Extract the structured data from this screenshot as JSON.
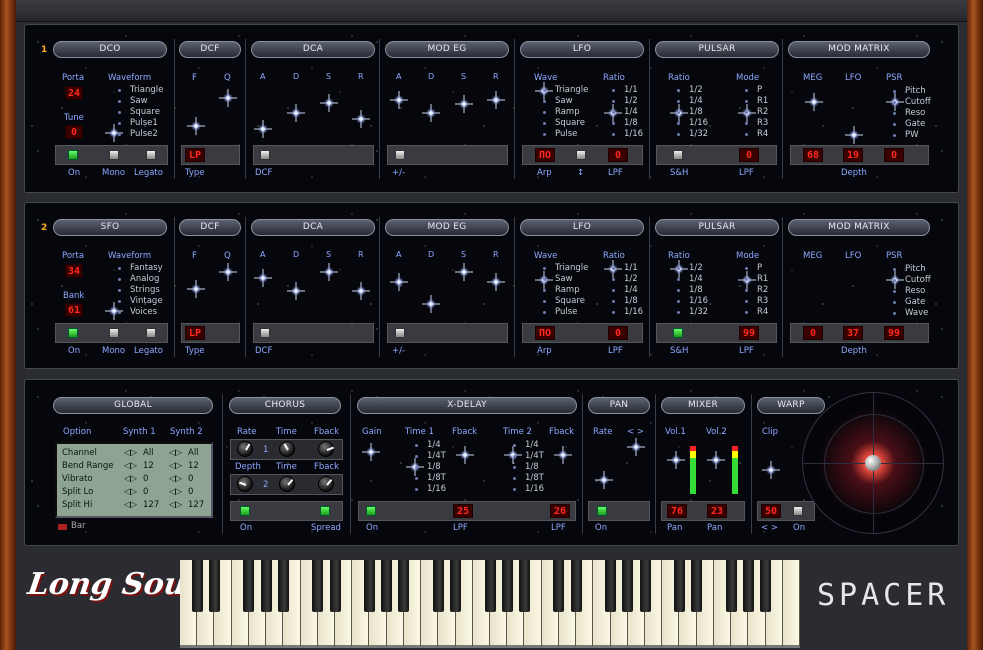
{
  "app": {
    "logo": "Long Sound",
    "product": "SPACER"
  },
  "voice1": {
    "num": "1",
    "dco": "DCO",
    "dcf": "DCF",
    "dca": "DCA",
    "modeg": "MOD EG",
    "lfo": "LFO",
    "pulsar": "PULSAR",
    "matrix": "MOD MATRIX",
    "porta_l": "Porta",
    "porta_v": "24",
    "tune_l": "Tune",
    "tune_v": "0",
    "waveform_l": "Waveform",
    "waves": [
      "Triangle",
      "Saw",
      "Square",
      "Pulse1",
      "Pulse2"
    ],
    "f_l": "F",
    "q_l": "Q",
    "type_v": "LP",
    "type_l": "Type",
    "on_l": "On",
    "mono_l": "Mono",
    "legato_l": "Legato",
    "adsr": [
      "A",
      "D",
      "S",
      "R"
    ],
    "dcf_l": "DCF",
    "pm_l": "+/-",
    "wave_l": "Wave",
    "ratio_l": "Ratio",
    "lfo_waves": [
      "Triangle",
      "Saw",
      "Ramp",
      "Square",
      "Pulse"
    ],
    "lfo_ratios": [
      "1/1",
      "1/2",
      "1/4",
      "1/8",
      "1/16"
    ],
    "arp_v": "ΠΟ",
    "arp_l": "Arp",
    "sync_l": "↕",
    "lpf_v": "0",
    "lpf_l": "LPF",
    "p_ratio_l": "Ratio",
    "p_mode_l": "Mode",
    "p_ratios": [
      "1/2",
      "1/4",
      "1/8",
      "1/16",
      "1/32"
    ],
    "p_modes": [
      "P",
      "R1",
      "R2",
      "R3",
      "R4"
    ],
    "sh_l": "S&H",
    "p_lpf_v": "0",
    "p_lpf_l": "LPF",
    "meg_l": "MEG",
    "mlfo_l": "LFO",
    "psr_l": "PSR",
    "dests": [
      "Pitch",
      "Cutoff",
      "Reso",
      "Gate",
      "PW"
    ],
    "d1": "68",
    "d2": "19",
    "d3": "0",
    "depth_l": "Depth"
  },
  "voice2": {
    "num": "2",
    "sfo": "SFO",
    "dcf": "DCF",
    "dca": "DCA",
    "modeg": "MOD EG",
    "lfo": "LFO",
    "pulsar": "PULSAR",
    "matrix": "MOD MATRIX",
    "porta_l": "Porta",
    "porta_v": "34",
    "bank_l": "Bank",
    "bank_v": "61",
    "waveform_l": "Waveform",
    "waves": [
      "Fantasy",
      "Analog",
      "Strings",
      "Vintage",
      "Voices"
    ],
    "f_l": "F",
    "q_l": "Q",
    "type_v": "LP",
    "type_l": "Type",
    "on_l": "On",
    "mono_l": "Mono",
    "legato_l": "Legato",
    "adsr": [
      "A",
      "D",
      "S",
      "R"
    ],
    "dcf_l": "DCF",
    "pm_l": "+/-",
    "wave_l": "Wave",
    "ratio_l": "Ratio",
    "lfo_waves": [
      "Triangle",
      "Saw",
      "Ramp",
      "Square",
      "Pulse"
    ],
    "lfo_ratios": [
      "1/1",
      "1/2",
      "1/4",
      "1/8",
      "1/16"
    ],
    "arp_v": "ΠΟ",
    "arp_l": "Arp",
    "lpf_v": "0",
    "lpf_l": "LPF",
    "p_ratio_l": "Ratio",
    "p_mode_l": "Mode",
    "p_ratios": [
      "1/2",
      "1/4",
      "1/8",
      "1/16",
      "1/32"
    ],
    "p_modes": [
      "P",
      "R1",
      "R2",
      "R3",
      "R4"
    ],
    "sh_l": "S&H",
    "p_lpf_v": "99",
    "p_lpf_l": "LPF",
    "meg_l": "MEG",
    "mlfo_l": "LFO",
    "psr_l": "PSR",
    "dests": [
      "Pitch",
      "Cutoff",
      "Reso",
      "Gate",
      "Wave"
    ],
    "d1": "0",
    "d2": "37",
    "d3": "99",
    "depth_l": "Depth"
  },
  "global": {
    "title": "GLOBAL",
    "option_l": "Option",
    "s1_l": "Synth 1",
    "s2_l": "Synth 2",
    "rows": [
      {
        "k": "Channel",
        "a": "All",
        "b": "All"
      },
      {
        "k": "Bend Range",
        "a": "12",
        "b": "12"
      },
      {
        "k": "Vibrato",
        "a": "0",
        "b": "0"
      },
      {
        "k": "Split Lo",
        "a": "0",
        "b": "0"
      },
      {
        "k": "Split Hi",
        "a": "127",
        "b": "127"
      }
    ],
    "bar_l": "Bar"
  },
  "chorus": {
    "title": "CHORUS",
    "rate_l": "Rate",
    "time_l": "Time",
    "fback_l": "Fback",
    "depth_l": "Depth",
    "n1": "1",
    "n2": "2",
    "on_l": "On",
    "spread_l": "Spread"
  },
  "xdelay": {
    "title": "X-DELAY",
    "gain_l": "Gain",
    "time1_l": "Time   1",
    "fback1_l": "Fback",
    "time2_l": "Time   2",
    "fback2_l": "Fback",
    "times": [
      "1/4",
      "1/4T",
      "1/8",
      "1/8T",
      "1/16"
    ],
    "lpf1_v": "25",
    "lpf2_v": "26",
    "on_l": "On",
    "lpf_l": "LPF"
  },
  "pan": {
    "title": "PAN",
    "rate_l": "Rate",
    "lr_l": "< >",
    "on_l": "On"
  },
  "mixer": {
    "title": "MIXER",
    "vol1_l": "Vol.1",
    "vol2_l": "Vol.2",
    "pan1_v": "76",
    "pan2_v": "23",
    "pan_l": "Pan"
  },
  "warp": {
    "title": "WARP",
    "clip_l": "Clip",
    "clip_v": "50",
    "lr_l": "< >",
    "on_l": "On"
  }
}
